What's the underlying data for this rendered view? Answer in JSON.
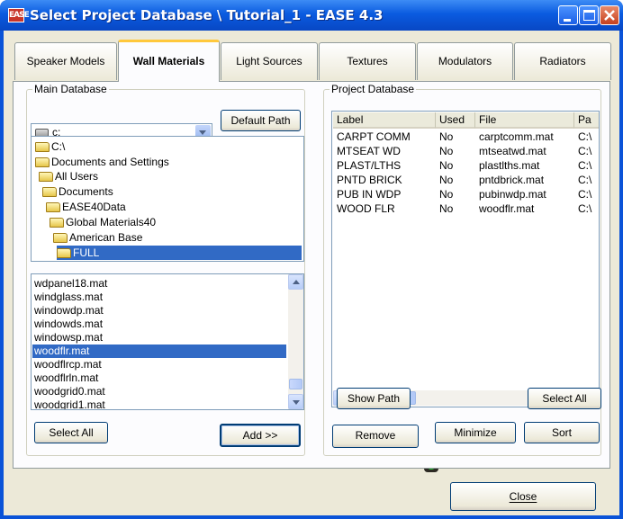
{
  "window": {
    "title": "Select Project Database \\ Tutorial_1 - EASE 4.3",
    "app_icon_text": "EASE"
  },
  "tabs": [
    {
      "label": "Speaker Models"
    },
    {
      "label": "Wall Materials",
      "active": true
    },
    {
      "label": "Light Sources"
    },
    {
      "label": "Textures"
    },
    {
      "label": "Modulators"
    },
    {
      "label": "Radiators"
    }
  ],
  "main_db": {
    "group_label": "Main Database",
    "drive_value": "c:",
    "default_path_label": "Default Path",
    "tree": [
      {
        "label": "C:\\"
      },
      {
        "label": "Documents and Settings"
      },
      {
        "label": "All Users"
      },
      {
        "label": "Documents"
      },
      {
        "label": "EASE40Data"
      },
      {
        "label": "Global Materials40"
      },
      {
        "label": "American Base"
      },
      {
        "label": "FULL",
        "selected": true
      }
    ],
    "files": [
      {
        "label": "wdpanel18.mat"
      },
      {
        "label": "windglass.mat"
      },
      {
        "label": "windowdp.mat"
      },
      {
        "label": "windowds.mat"
      },
      {
        "label": "windowsp.mat"
      },
      {
        "label": "woodflr.mat",
        "selected": true
      },
      {
        "label": "woodflrcp.mat"
      },
      {
        "label": "woodflrln.mat"
      },
      {
        "label": "woodgrid0.mat"
      },
      {
        "label": "woodgrid1.mat"
      }
    ],
    "select_all_label": "Select All",
    "add_label": "Add >>"
  },
  "project_db": {
    "group_label": "Project Database",
    "columns": [
      "Label",
      "Used",
      "File",
      "Pa"
    ],
    "rows": [
      [
        "CARPT COMM",
        "No",
        "carptcomm.mat",
        "C:\\"
      ],
      [
        "MTSEAT WD",
        "No",
        "mtseatwd.mat",
        "C:\\"
      ],
      [
        "PLAST/LTHS",
        "No",
        "plastlths.mat",
        "C:\\"
      ],
      [
        "PNTD BRICK",
        "No",
        "pntdbrick.mat",
        "C:\\"
      ],
      [
        "PUB IN WDP",
        "No",
        "pubinwdp.mat",
        "C:\\"
      ],
      [
        "WOOD FLR",
        "No",
        "woodflr.mat",
        "C:\\"
      ]
    ],
    "show_path_label": "Show Path",
    "select_all_label": "Select All",
    "remove_label": "Remove",
    "minimize_label": "Minimize",
    "sort_label": "Sort"
  },
  "footer": {
    "close_label": "Close"
  },
  "colors": {
    "titlebar": "#0a5be0",
    "selection": "#316ac5",
    "dialog_bg": "#ece9d8",
    "active_tab_accent": "#ffc83c"
  }
}
